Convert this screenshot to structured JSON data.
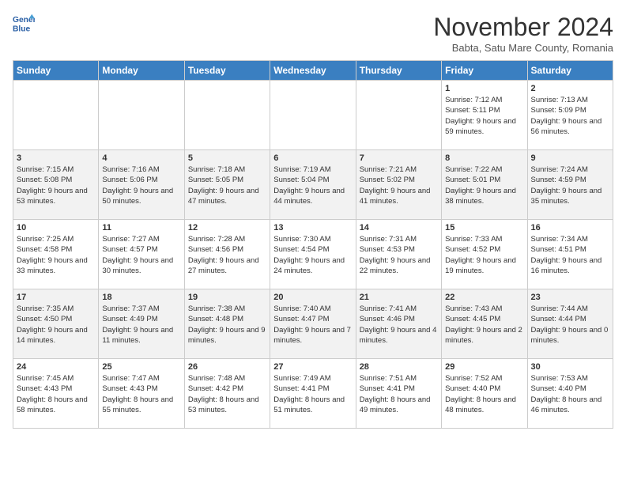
{
  "header": {
    "logo_line1": "General",
    "logo_line2": "Blue",
    "month": "November 2024",
    "location": "Babta, Satu Mare County, Romania"
  },
  "weekdays": [
    "Sunday",
    "Monday",
    "Tuesday",
    "Wednesday",
    "Thursday",
    "Friday",
    "Saturday"
  ],
  "weeks": [
    [
      {
        "day": "",
        "info": ""
      },
      {
        "day": "",
        "info": ""
      },
      {
        "day": "",
        "info": ""
      },
      {
        "day": "",
        "info": ""
      },
      {
        "day": "",
        "info": ""
      },
      {
        "day": "1",
        "info": "Sunrise: 7:12 AM\nSunset: 5:11 PM\nDaylight: 9 hours and 59 minutes."
      },
      {
        "day": "2",
        "info": "Sunrise: 7:13 AM\nSunset: 5:09 PM\nDaylight: 9 hours and 56 minutes."
      }
    ],
    [
      {
        "day": "3",
        "info": "Sunrise: 7:15 AM\nSunset: 5:08 PM\nDaylight: 9 hours and 53 minutes."
      },
      {
        "day": "4",
        "info": "Sunrise: 7:16 AM\nSunset: 5:06 PM\nDaylight: 9 hours and 50 minutes."
      },
      {
        "day": "5",
        "info": "Sunrise: 7:18 AM\nSunset: 5:05 PM\nDaylight: 9 hours and 47 minutes."
      },
      {
        "day": "6",
        "info": "Sunrise: 7:19 AM\nSunset: 5:04 PM\nDaylight: 9 hours and 44 minutes."
      },
      {
        "day": "7",
        "info": "Sunrise: 7:21 AM\nSunset: 5:02 PM\nDaylight: 9 hours and 41 minutes."
      },
      {
        "day": "8",
        "info": "Sunrise: 7:22 AM\nSunset: 5:01 PM\nDaylight: 9 hours and 38 minutes."
      },
      {
        "day": "9",
        "info": "Sunrise: 7:24 AM\nSunset: 4:59 PM\nDaylight: 9 hours and 35 minutes."
      }
    ],
    [
      {
        "day": "10",
        "info": "Sunrise: 7:25 AM\nSunset: 4:58 PM\nDaylight: 9 hours and 33 minutes."
      },
      {
        "day": "11",
        "info": "Sunrise: 7:27 AM\nSunset: 4:57 PM\nDaylight: 9 hours and 30 minutes."
      },
      {
        "day": "12",
        "info": "Sunrise: 7:28 AM\nSunset: 4:56 PM\nDaylight: 9 hours and 27 minutes."
      },
      {
        "day": "13",
        "info": "Sunrise: 7:30 AM\nSunset: 4:54 PM\nDaylight: 9 hours and 24 minutes."
      },
      {
        "day": "14",
        "info": "Sunrise: 7:31 AM\nSunset: 4:53 PM\nDaylight: 9 hours and 22 minutes."
      },
      {
        "day": "15",
        "info": "Sunrise: 7:33 AM\nSunset: 4:52 PM\nDaylight: 9 hours and 19 minutes."
      },
      {
        "day": "16",
        "info": "Sunrise: 7:34 AM\nSunset: 4:51 PM\nDaylight: 9 hours and 16 minutes."
      }
    ],
    [
      {
        "day": "17",
        "info": "Sunrise: 7:35 AM\nSunset: 4:50 PM\nDaylight: 9 hours and 14 minutes."
      },
      {
        "day": "18",
        "info": "Sunrise: 7:37 AM\nSunset: 4:49 PM\nDaylight: 9 hours and 11 minutes."
      },
      {
        "day": "19",
        "info": "Sunrise: 7:38 AM\nSunset: 4:48 PM\nDaylight: 9 hours and 9 minutes."
      },
      {
        "day": "20",
        "info": "Sunrise: 7:40 AM\nSunset: 4:47 PM\nDaylight: 9 hours and 7 minutes."
      },
      {
        "day": "21",
        "info": "Sunrise: 7:41 AM\nSunset: 4:46 PM\nDaylight: 9 hours and 4 minutes."
      },
      {
        "day": "22",
        "info": "Sunrise: 7:43 AM\nSunset: 4:45 PM\nDaylight: 9 hours and 2 minutes."
      },
      {
        "day": "23",
        "info": "Sunrise: 7:44 AM\nSunset: 4:44 PM\nDaylight: 9 hours and 0 minutes."
      }
    ],
    [
      {
        "day": "24",
        "info": "Sunrise: 7:45 AM\nSunset: 4:43 PM\nDaylight: 8 hours and 58 minutes."
      },
      {
        "day": "25",
        "info": "Sunrise: 7:47 AM\nSunset: 4:43 PM\nDaylight: 8 hours and 55 minutes."
      },
      {
        "day": "26",
        "info": "Sunrise: 7:48 AM\nSunset: 4:42 PM\nDaylight: 8 hours and 53 minutes."
      },
      {
        "day": "27",
        "info": "Sunrise: 7:49 AM\nSunset: 4:41 PM\nDaylight: 8 hours and 51 minutes."
      },
      {
        "day": "28",
        "info": "Sunrise: 7:51 AM\nSunset: 4:41 PM\nDaylight: 8 hours and 49 minutes."
      },
      {
        "day": "29",
        "info": "Sunrise: 7:52 AM\nSunset: 4:40 PM\nDaylight: 8 hours and 48 minutes."
      },
      {
        "day": "30",
        "info": "Sunrise: 7:53 AM\nSunset: 4:40 PM\nDaylight: 8 hours and 46 minutes."
      }
    ]
  ]
}
